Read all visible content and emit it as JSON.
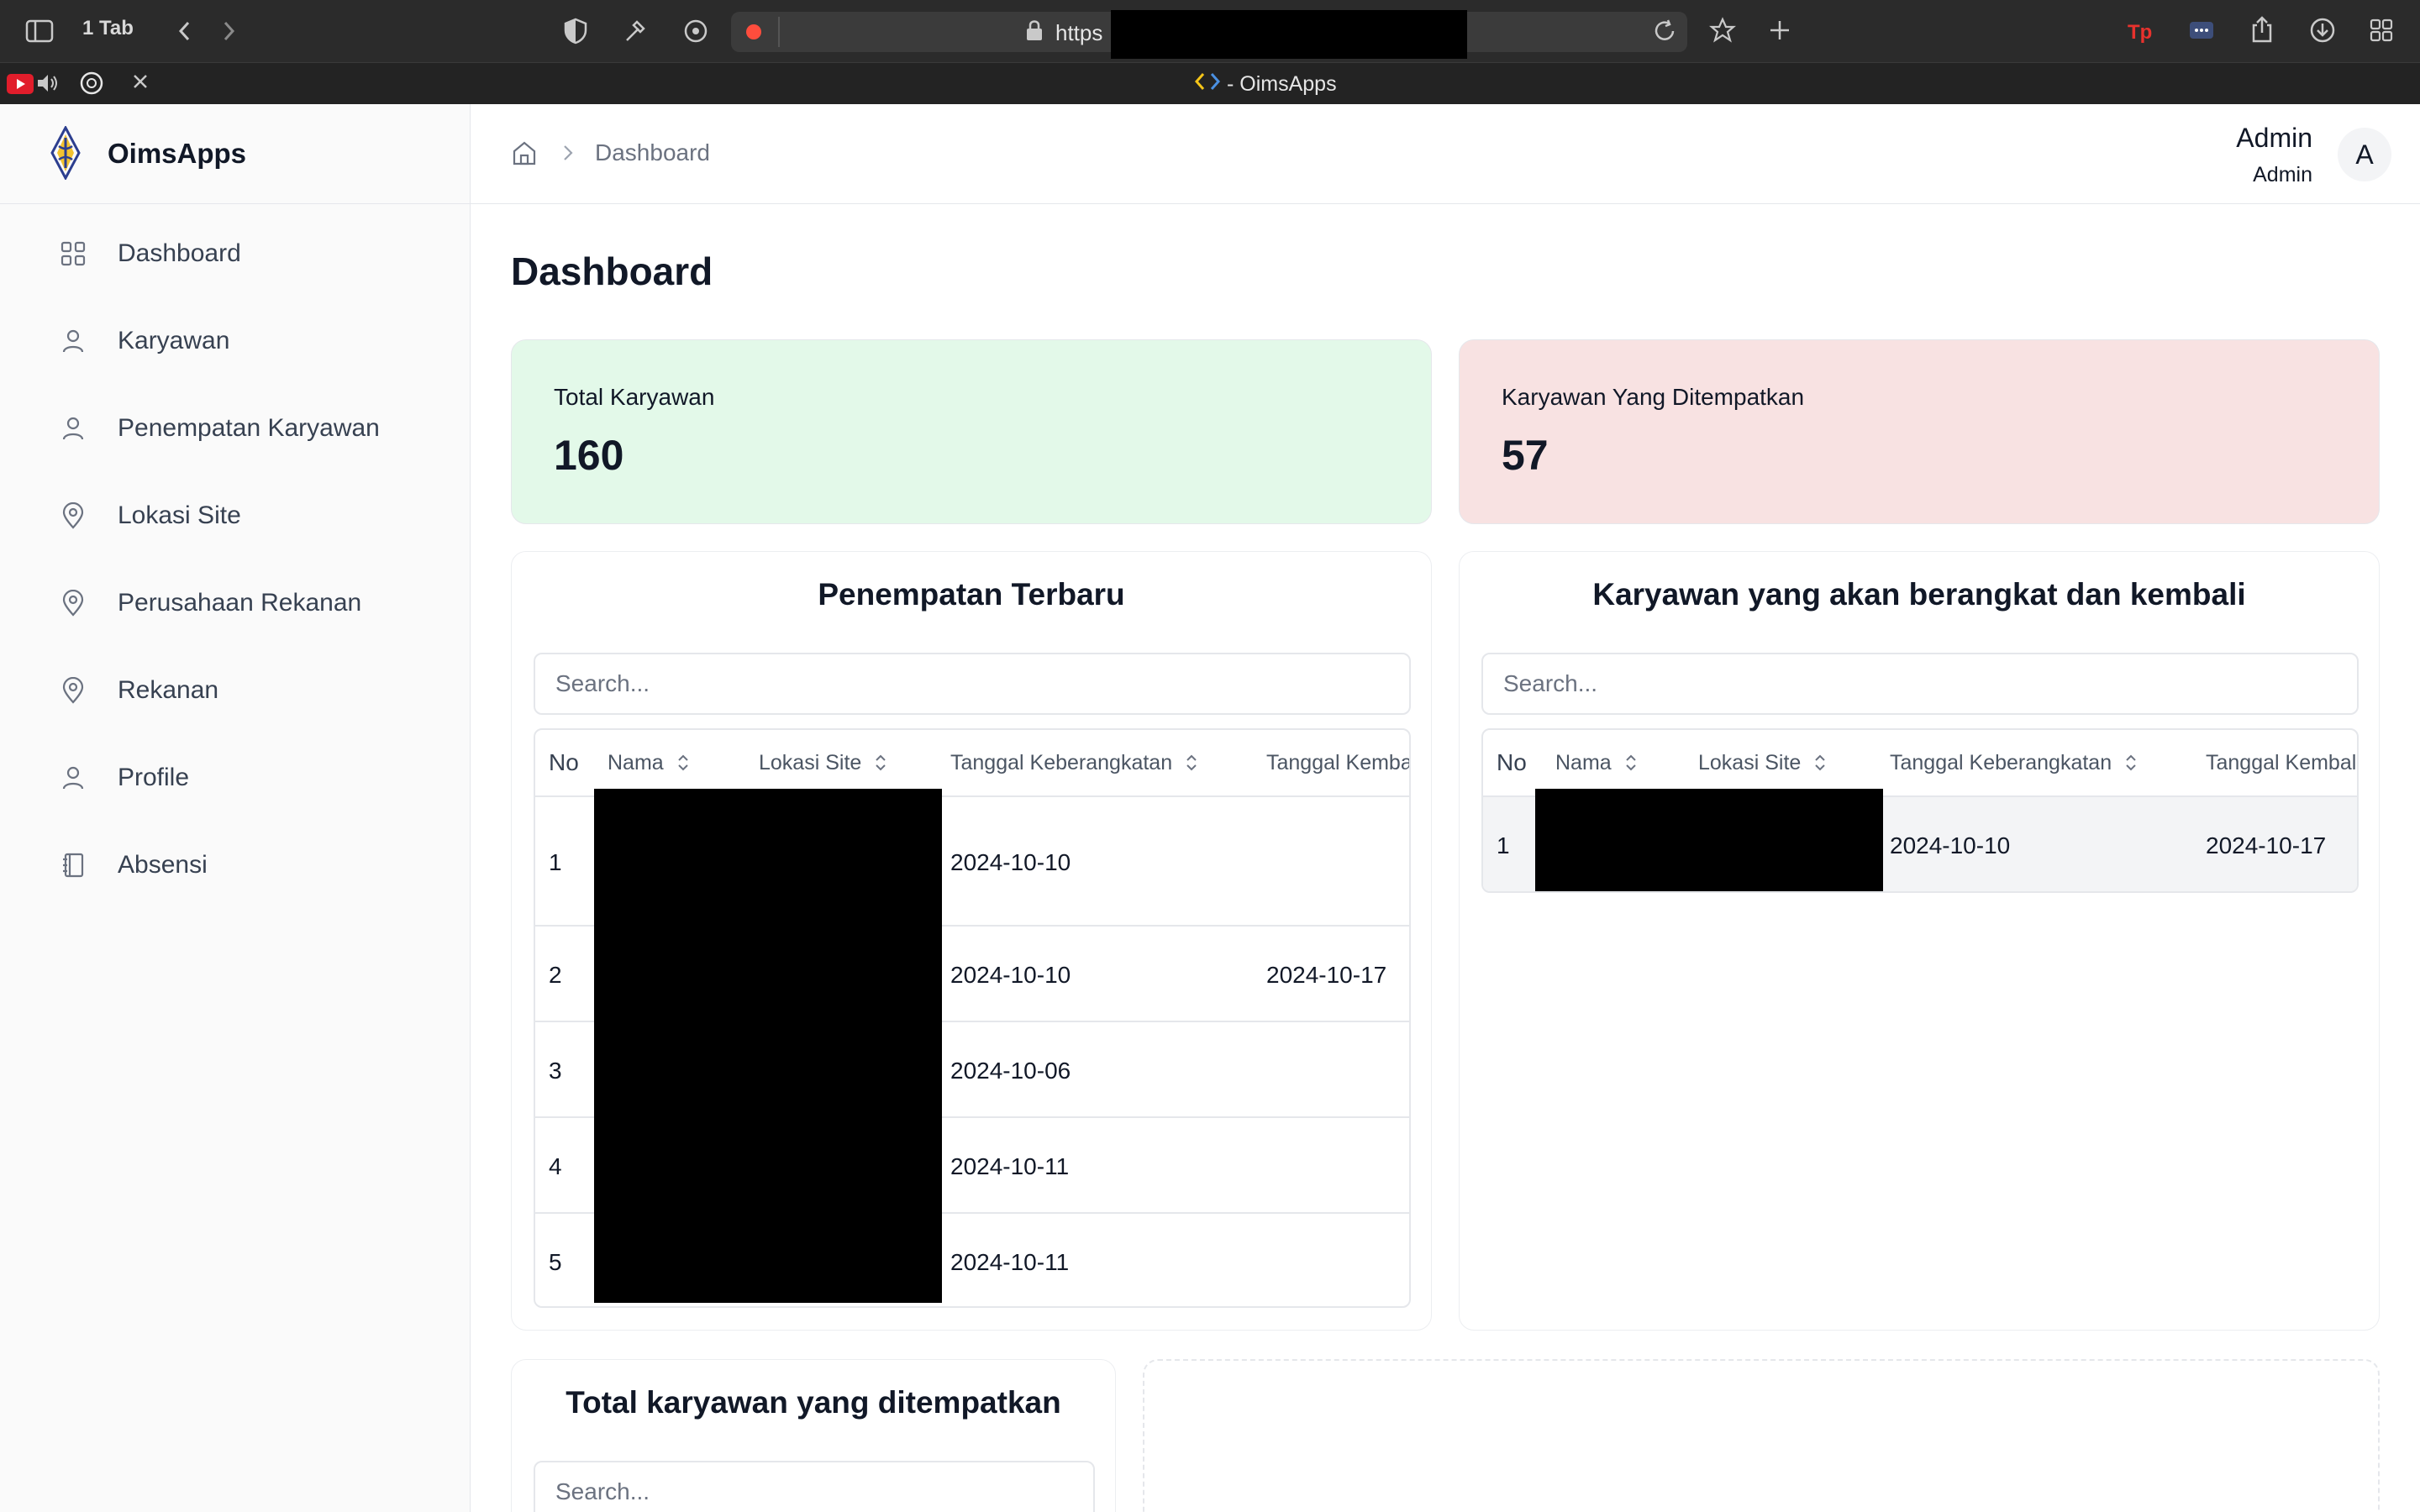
{
  "browser": {
    "tab_count_label": "1 Tab",
    "url_text": "https",
    "tab_title": "- OimsApps"
  },
  "app": {
    "brand_name": "OimsApps"
  },
  "sidebar": {
    "items": [
      {
        "label": "Dashboard",
        "icon": "grid-icon"
      },
      {
        "label": "Karyawan",
        "icon": "user-icon"
      },
      {
        "label": "Penempatan Karyawan",
        "icon": "user-icon"
      },
      {
        "label": "Lokasi Site",
        "icon": "map-pin-icon"
      },
      {
        "label": "Perusahaan Rekanan",
        "icon": "map-pin-icon"
      },
      {
        "label": "Rekanan",
        "icon": "map-pin-icon"
      },
      {
        "label": "Profile",
        "icon": "user-icon"
      },
      {
        "label": "Absensi",
        "icon": "book-icon"
      }
    ]
  },
  "header": {
    "breadcrumb": "Dashboard",
    "user_name": "Admin",
    "user_role": "Admin",
    "avatar_letter": "A"
  },
  "page": {
    "title": "Dashboard"
  },
  "stats": {
    "total_karyawan": {
      "label": "Total Karyawan",
      "value": "160",
      "color": "#e3f9e9"
    },
    "karyawan_ditempatkan": {
      "label": "Karyawan Yang Ditempatkan",
      "value": "57",
      "color": "#f8e2e2"
    }
  },
  "penempatan_terbaru": {
    "title": "Penempatan Terbaru",
    "search_placeholder": "Search...",
    "columns": [
      "No",
      "Nama",
      "Lokasi Site",
      "Tanggal Keberangkatan",
      "Tanggal Kemba"
    ],
    "rows": [
      {
        "no": "1",
        "tanggal_keberangkatan": "2024-10-10",
        "tanggal_kembali": ""
      },
      {
        "no": "2",
        "tanggal_keberangkatan": "2024-10-10",
        "tanggal_kembali": "2024-10-17"
      },
      {
        "no": "3",
        "tanggal_keberangkatan": "2024-10-06",
        "tanggal_kembali": ""
      },
      {
        "no": "4",
        "tanggal_keberangkatan": "2024-10-11",
        "tanggal_kembali": ""
      },
      {
        "no": "5",
        "tanggal_keberangkatan": "2024-10-11",
        "tanggal_kembali": ""
      }
    ]
  },
  "berangkat_kembali": {
    "title": "Karyawan yang akan berangkat dan kembali",
    "search_placeholder": "Search...",
    "columns": [
      "No",
      "Nama",
      "Lokasi Site",
      "Tanggal Keberangkatan",
      "Tanggal Kembal"
    ],
    "rows": [
      {
        "no": "1",
        "tanggal_keberangkatan": "2024-10-10",
        "tanggal_kembali": "2024-10-17"
      }
    ]
  },
  "total_ditempatkan": {
    "title": "Total karyawan yang ditempatkan",
    "search_placeholder": "Search..."
  }
}
